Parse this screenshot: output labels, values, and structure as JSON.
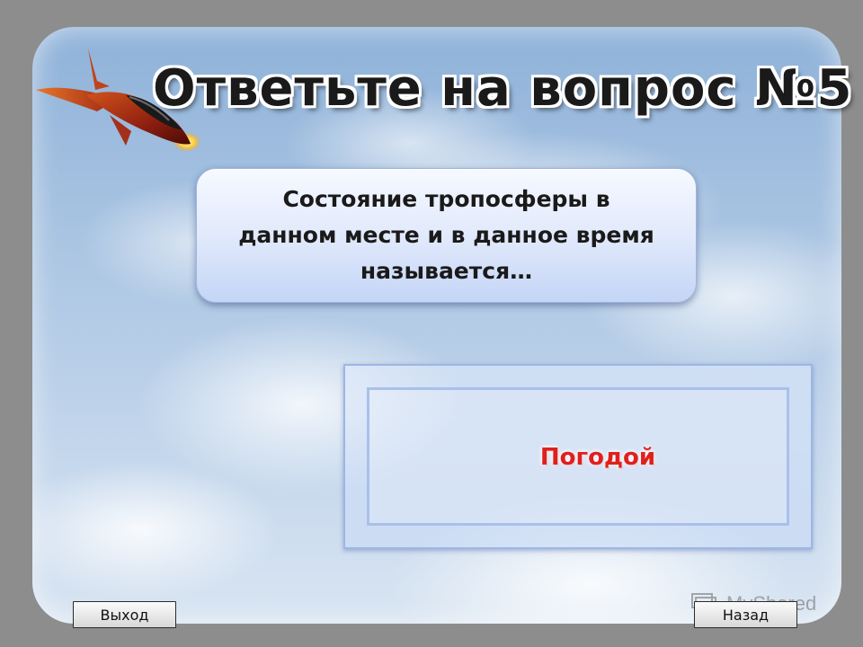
{
  "slide": {
    "title": "Ответьте на вопрос №5",
    "question": "Состояние тропосферы в данном месте и в данное время называется…",
    "answer": "Погодой"
  },
  "navigation": {
    "exit_label": "Выход",
    "back_label": "Назад"
  },
  "watermark": {
    "text": "MyShared",
    "icon": "presentation-icon"
  },
  "colors": {
    "answer_text": "#e0201d",
    "question_box": "#dfe8fb",
    "frame_border": "#8d8d8d"
  },
  "icons": {
    "decoration": "rocket-icon"
  }
}
